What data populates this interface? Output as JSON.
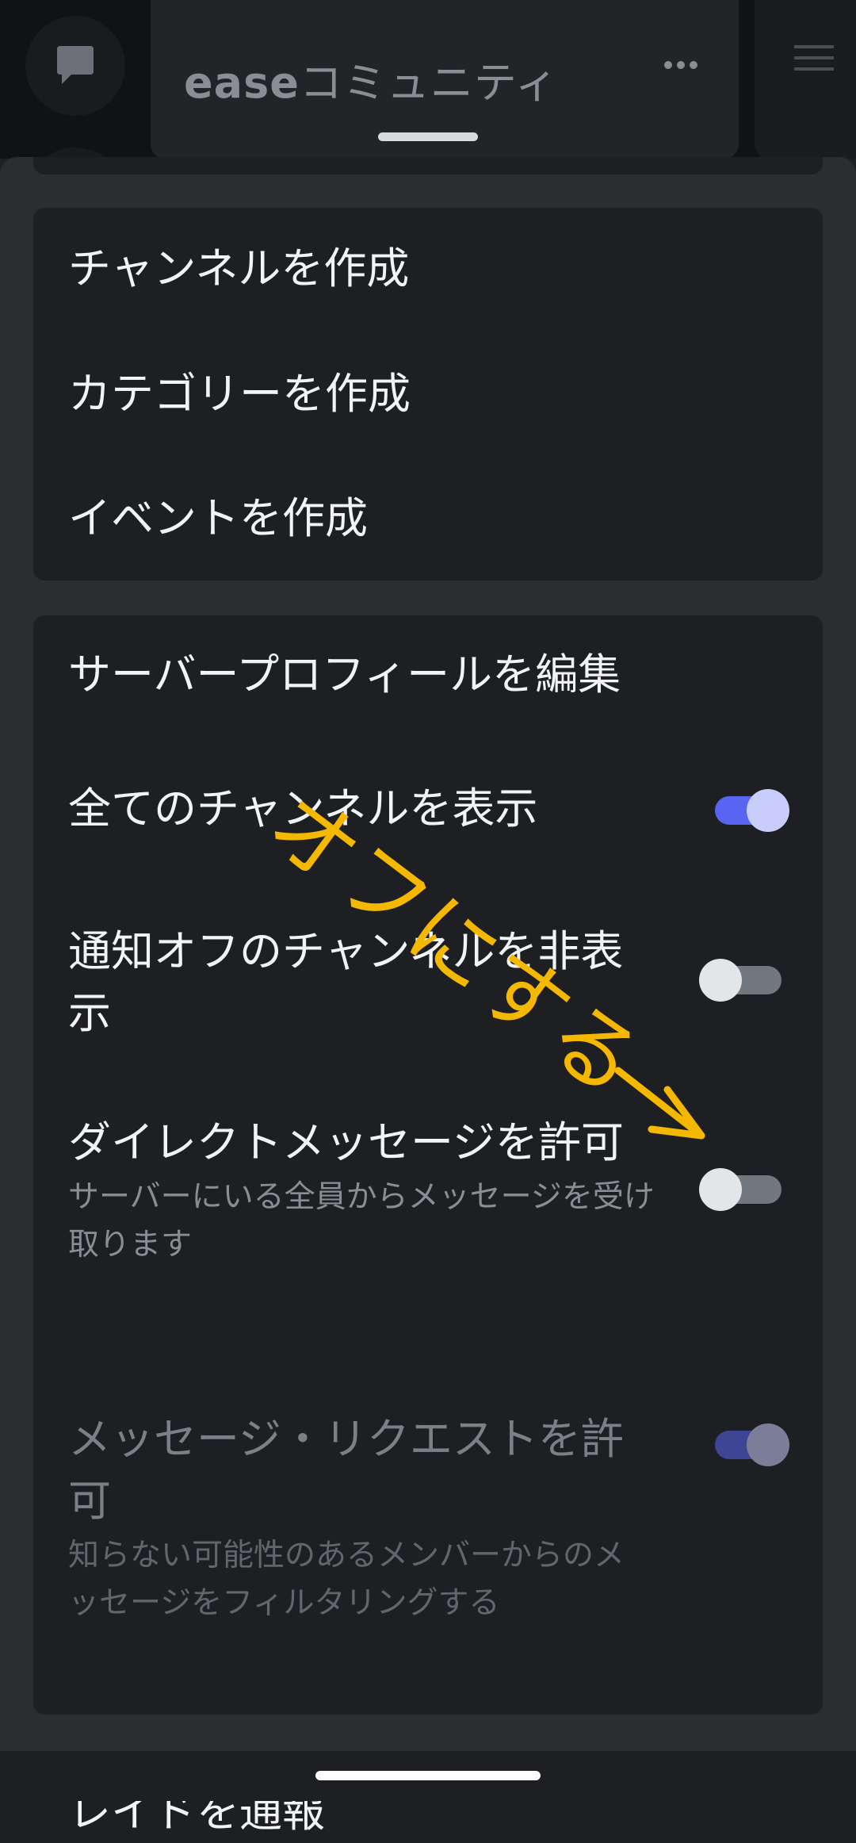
{
  "header": {
    "server_name_latin": "ease",
    "server_name_jp": "コミュニティ",
    "icons": [
      "chat-bubble-icon",
      "more-dots-icon",
      "hamburger-icon"
    ]
  },
  "group1": {
    "items": [
      {
        "label": "チャンネルを作成"
      },
      {
        "label": "カテゴリーを作成"
      },
      {
        "label": "イベントを作成"
      }
    ]
  },
  "group2": {
    "edit_profile": {
      "label": "サーバープロフィールを編集"
    },
    "show_all_channels": {
      "label": "全てのチャンネルを表示",
      "toggle": "on"
    },
    "hide_muted": {
      "label": "通知オフのチャンネルを非表示",
      "toggle": "off"
    },
    "allow_dm": {
      "label": "ダイレクトメッセージを許可",
      "description": "サーバーにいる全員からメッセージを受け取ります",
      "toggle": "off"
    },
    "allow_message_requests": {
      "label": "メッセージ・リクエストを許可",
      "description": "知らない可能性のあるメンバーからのメッセージをフィルタリングする",
      "toggle": "on",
      "disabled": true
    },
    "report_raid": {
      "label": "レイドを通報"
    }
  },
  "annotation": {
    "text": "オフにする",
    "color": "#f5b800"
  },
  "colors": {
    "accent": "#5865f2",
    "sheet": "#2b2d31",
    "card": "#1e1f22"
  }
}
